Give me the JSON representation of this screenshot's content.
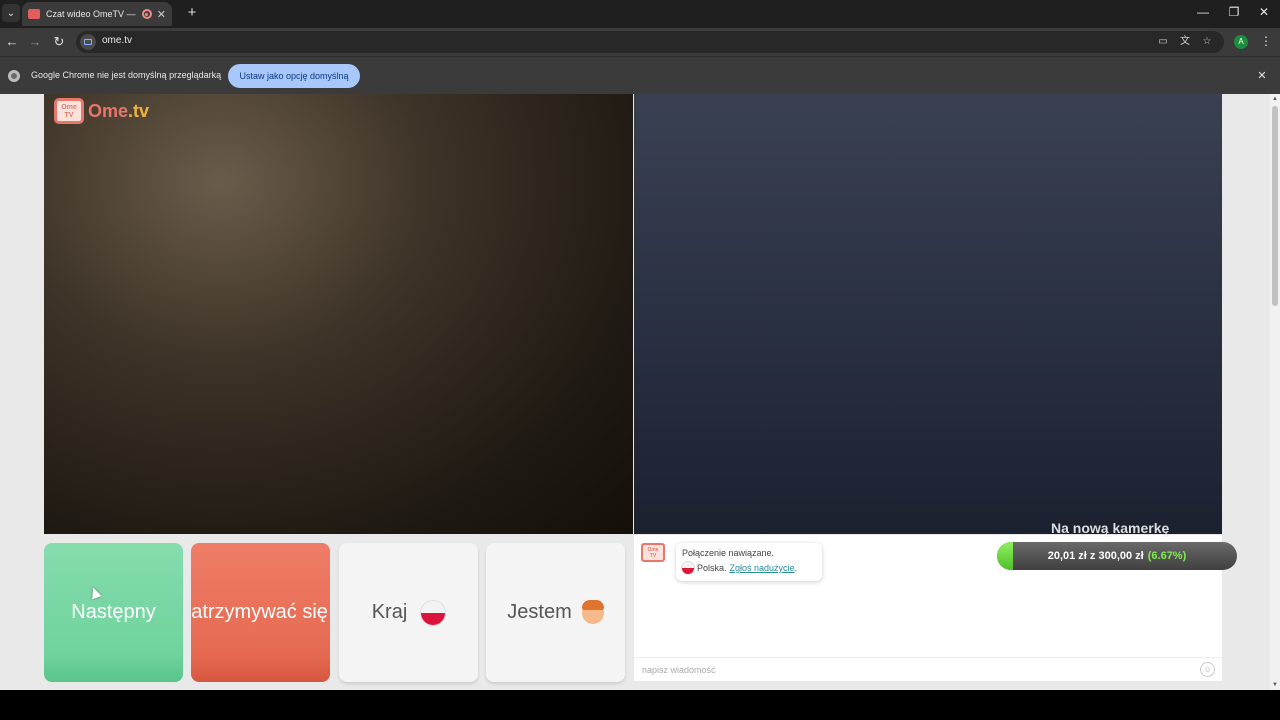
{
  "browser": {
    "tab_title": "Czat wideo OmeTV — alternatywa",
    "new_tab_symbol": "+",
    "url": "ome.tv",
    "window_controls": {
      "minimize": "—",
      "restore": "❐",
      "close": "✕"
    },
    "profile_initial": "A"
  },
  "infobar": {
    "message": "Google Chrome nie jest domyślną przeglądarką",
    "button_label": "Ustaw jako opcję domyślną",
    "close_symbol": "✕"
  },
  "logo": {
    "badge": "Ome\nTV",
    "text_main": "Ome",
    "text_dot": ".tv"
  },
  "buttons": {
    "next": "Następny",
    "stop": "Zatrzymywać się",
    "country": "Kraj",
    "me": "Jestem"
  },
  "chat": {
    "logo_badge": "Ome TV",
    "system_message": "Połączenie nawiązane.",
    "country": "Polska",
    "separator": " .",
    "report_link": "Zgłoś nadużycie",
    "period": ".",
    "input_placeholder": "napisz wiadomość"
  },
  "donation": {
    "title": "Na nową kamerkę",
    "progress_text": "20,01 zł z 300,00 zł",
    "percent_text": "(6.67%)",
    "progress_fraction": 0.0667
  },
  "icons": {
    "tab_search": "tab-search-icon",
    "back": "back-arrow-icon",
    "forward": "forward-arrow-icon",
    "reload": "reload-icon",
    "cast": "cast-icon",
    "translate": "translate-icon",
    "bookmark": "star-icon",
    "menu": "kebab-menu-icon",
    "emoji": "emoji-icon"
  },
  "colors": {
    "next_green": "#6fd39d",
    "stop_red": "#e66a52",
    "brand": "#e7776a",
    "chrome_blue": "#a8c7fa"
  }
}
